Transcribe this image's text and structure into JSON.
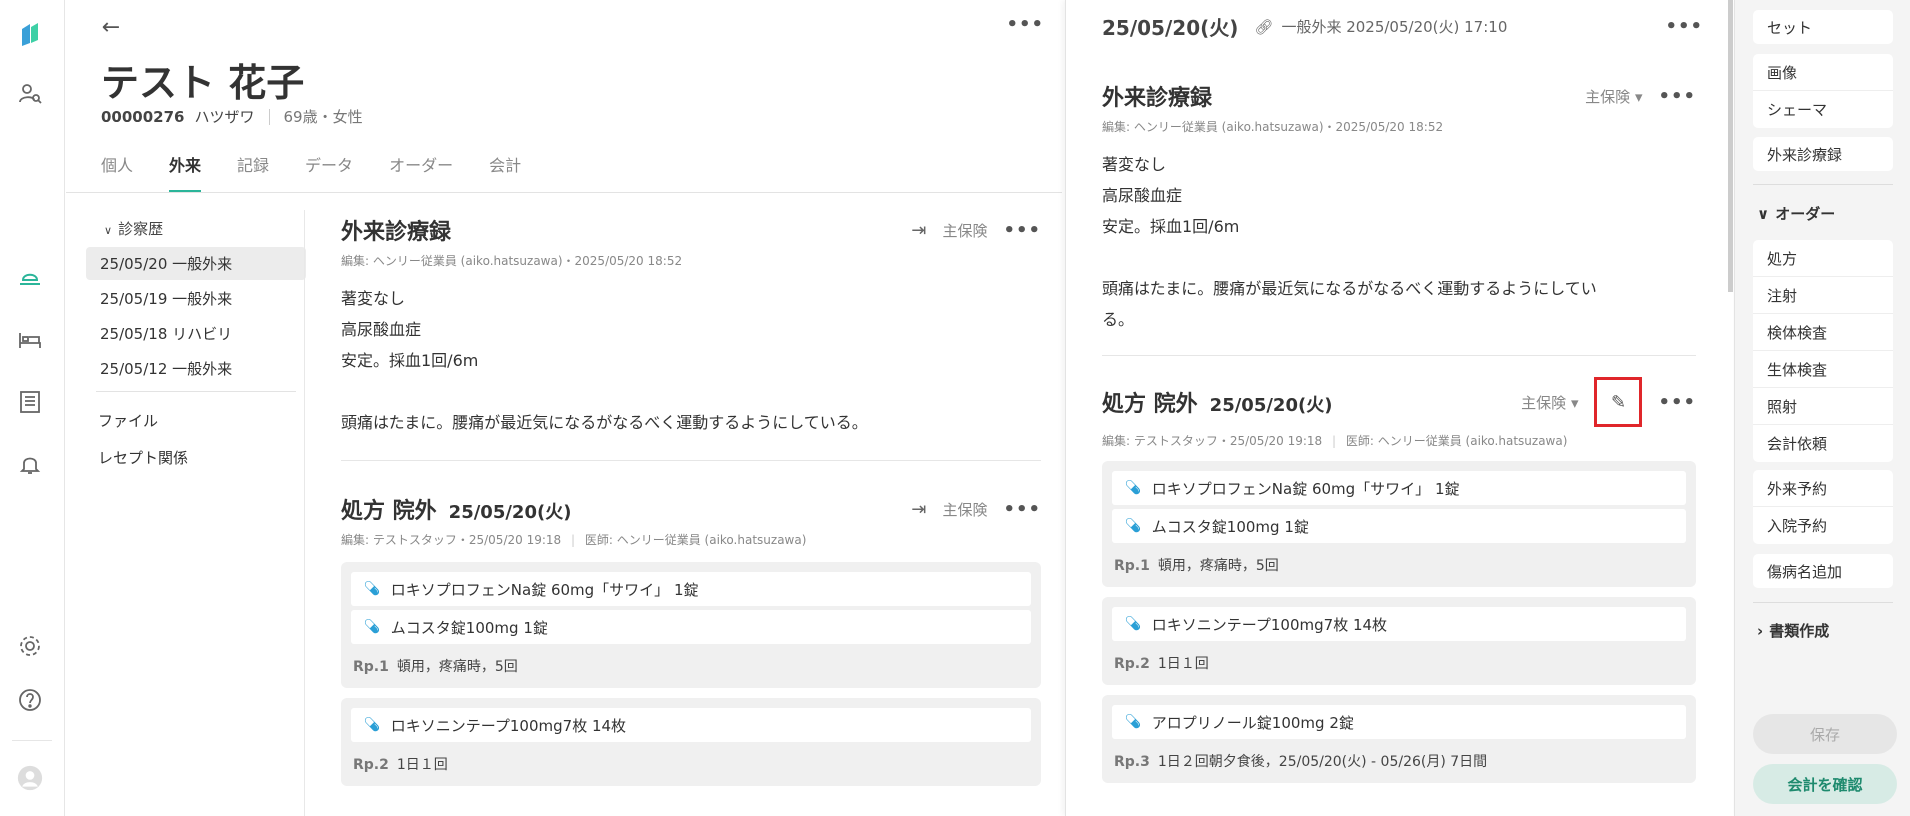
{
  "left_rail": {
    "icons": [
      "app-logo",
      "patient-search",
      "outpatient",
      "inpatient-bed",
      "list",
      "notifications",
      "settings",
      "help",
      "user-avatar"
    ]
  },
  "main": {
    "more_label": "•••",
    "patient": {
      "name": "テスト 花子",
      "id": "00000276",
      "kana": "ハツザワ",
      "age_sex": "69歳・女性"
    },
    "tabs": [
      "個人",
      "外来",
      "記録",
      "データ",
      "オーダー",
      "会計"
    ],
    "active_tab": "外来",
    "history": {
      "header": "診察歴",
      "items": [
        "25/05/20 一般外来",
        "25/05/19 一般外来",
        "25/05/18 リハビリ",
        "25/05/12 一般外来"
      ],
      "links": [
        "ファイル",
        "レセプト関係"
      ]
    },
    "record": {
      "title": "外来診療録",
      "insurance": "主保険",
      "edit_info": "編集: ヘンリー従業員 (aiko.hatsuzawa)・2025/05/20 18:52",
      "body": [
        "著変なし",
        "高尿酸血症",
        "安定。採血1回/6m",
        "",
        "頭痛はたまに。腰痛が最近気になるがなるべく運動するようにしている。"
      ]
    },
    "rx": {
      "title": "処方 院外",
      "date": "25/05/20(火)",
      "insurance": "主保険",
      "edit_info": "編集: テストスタッフ・25/05/20 19:18",
      "doctor": "医師: ヘンリー従業員 (aiko.hatsuzawa)",
      "rp1": {
        "drugs": [
          "ロキソプロフェンNa錠 60mg「サワイ」 1錠",
          "ムコスタ錠100mg 1錠"
        ],
        "label": "Rp.1",
        "usage": "頓用，疼痛時，5回"
      },
      "rp2": {
        "drugs": [
          "ロキソニンテープ100mg7枚 14枚"
        ],
        "label": "Rp.2",
        "usage": "1日１回"
      }
    }
  },
  "detail": {
    "date": "25/05/20(火)",
    "link_text": "一般外来 2025/05/20(火) 17:10",
    "more_label": "•••",
    "record": {
      "title": "外来診療録",
      "insurance": "主保険",
      "edit_info": "編集: ヘンリー従業員 (aiko.hatsuzawa)・2025/05/20 18:52",
      "body": [
        "著変なし",
        "高尿酸血症",
        "安定。採血1回/6m",
        "",
        "頭痛はたまに。腰痛が最近気になるがなるべく運動するようにしてい",
        "る。"
      ]
    },
    "rx": {
      "title": "処方 院外",
      "date": "25/05/20(火)",
      "insurance": "主保険",
      "edit_info": "編集: テストスタッフ・25/05/20 19:18",
      "doctor": "医師: ヘンリー従業員 (aiko.hatsuzawa)",
      "rp1": {
        "drugs": [
          "ロキソプロフェンNa錠 60mg「サワイ」 1錠",
          "ムコスタ錠100mg 1錠"
        ],
        "label": "Rp.1",
        "usage": "頓用，疼痛時，5回"
      },
      "rp2": {
        "drugs": [
          "ロキソニンテープ100mg7枚 14枚"
        ],
        "label": "Rp.2",
        "usage": "1日１回"
      },
      "rp3": {
        "drugs": [
          "アロプリノール錠100mg 2錠"
        ],
        "label": "Rp.3",
        "usage": "1日２回朝夕食後，25/05/20(火) - 05/26(月) 7日間"
      }
    }
  },
  "right_rail": {
    "set": "セット",
    "media": [
      "画像",
      "シェーマ"
    ],
    "record": "外来診療録",
    "order_header": "オーダー",
    "orders": [
      "処方",
      "注射",
      "検体検査",
      "生体検査",
      "照射",
      "会計依頼"
    ],
    "reservations": [
      "外来予約",
      "入院予約"
    ],
    "add_disease": "傷病名追加",
    "docs_header": "書類作成",
    "save": "保存",
    "confirm": "会計を確認"
  },
  "colors": {
    "accent": "#2bb59a",
    "highlight": "#e0262a",
    "pill_icon": "#2a9fd6"
  }
}
